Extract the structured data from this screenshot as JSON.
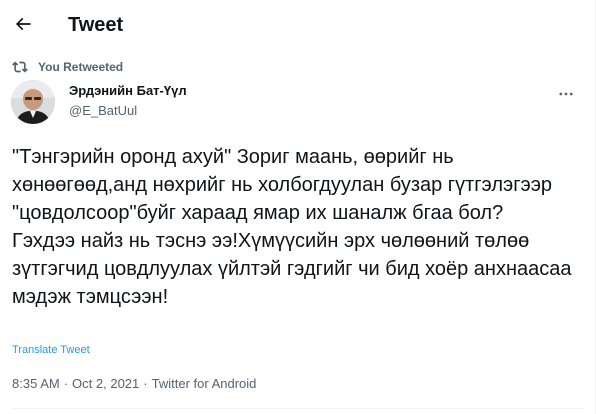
{
  "header": {
    "title": "Tweet",
    "back_icon": "arrow-left-icon"
  },
  "retweet": {
    "label": "You Retweeted",
    "icon": "retweet-icon"
  },
  "author": {
    "name": "Эрдэнийн Бат-Үүл",
    "handle": "@E_BatUul",
    "more_icon": "more-horizontal-icon"
  },
  "tweet": {
    "text": "\"Тэнгэрийн оронд ахуй\" Зориг маань, өөрийг нь хөнөөгөөд,анд нөхрийг нь холбогдуулан бузар гүтгэлэгээр \"цовдолсоор\"буйг хараад ямар их шаналж бгаа бол?\nГэхдээ найз нь тэснэ ээ!Хүмүүсийн эрх чөлөөний төлөө зүтгэгчид цовдлуулах үйлтэй гэдгийг чи бид хоёр анхнаасаа мэдэж тэмцсээн!",
    "translate_label": "Translate Tweet"
  },
  "meta": {
    "time": "8:35 AM",
    "separator": "·",
    "date": "Oct 2, 2021",
    "source": "Twitter for Android"
  },
  "colors": {
    "text": "#0f1419",
    "secondary": "#536471",
    "accent": "#1d9bf0"
  }
}
